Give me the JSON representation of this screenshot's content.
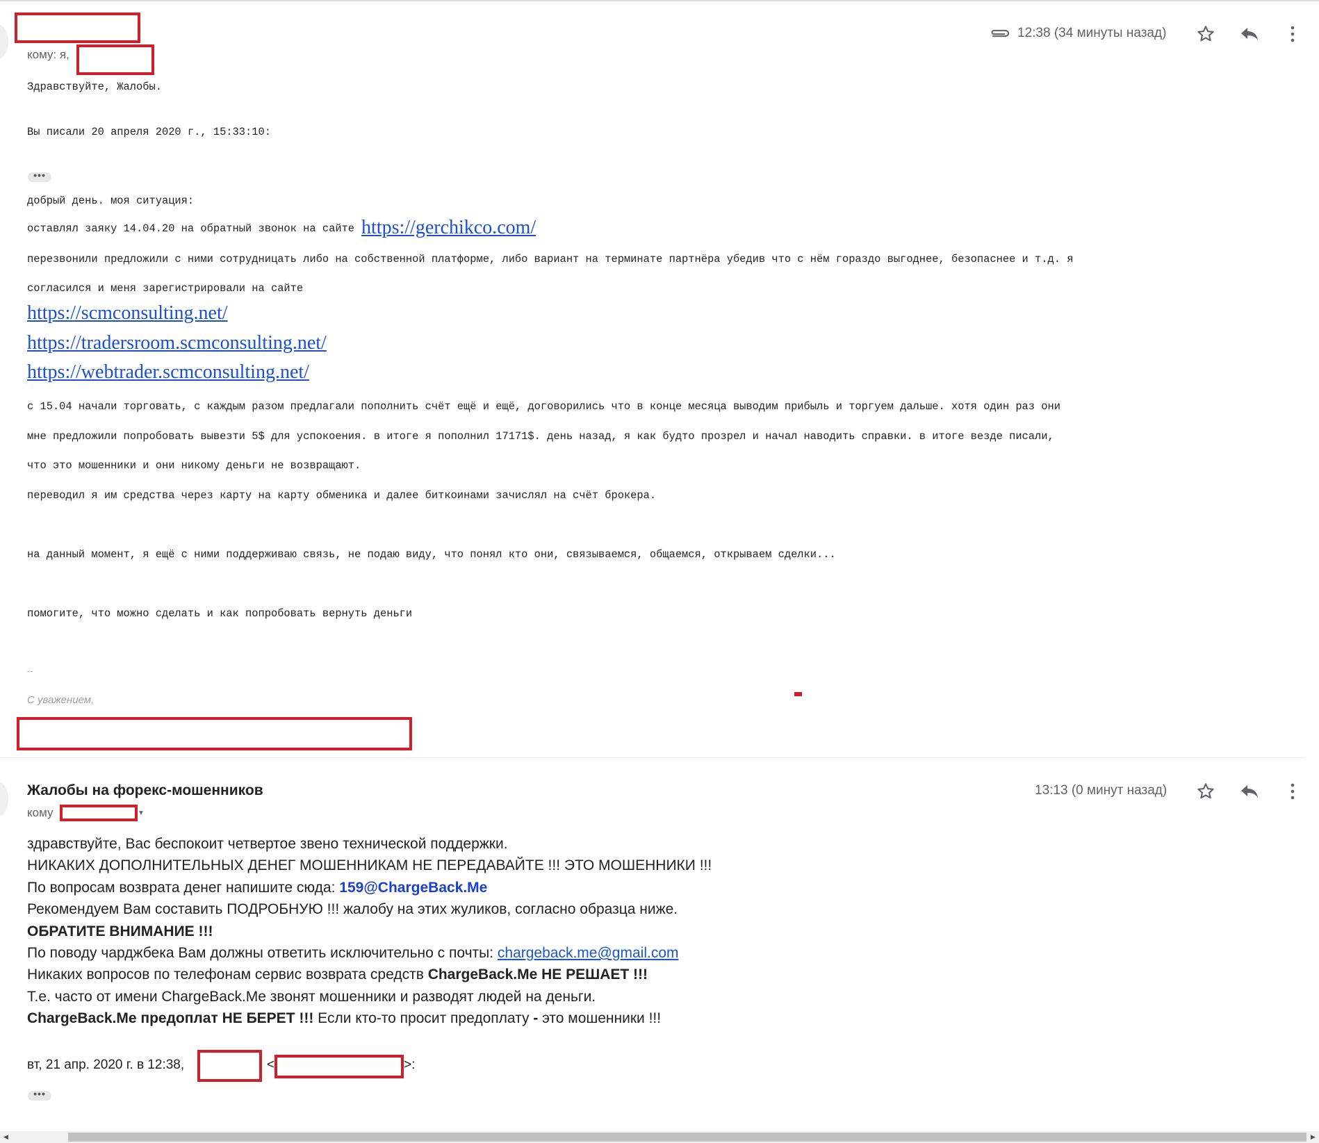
{
  "message1": {
    "to_label": "кому: я,",
    "time": "12:38 (34 минуты назад)",
    "icons": [
      "attachment-icon",
      "star-icon",
      "reply-icon",
      "more-vert-icon"
    ],
    "lines": {
      "greeting": "Здравствуйте, Жалобы.",
      "wrote": "Вы писали 20 апреля 2020 г., 15:33:10:",
      "ellipsis": "•••",
      "p1": "добрый день. моя ситуация:",
      "p2_text": "оставлял заяку 14.04.20 на обратный звонок на сайте",
      "p2_link": "https://gerchikco.com/",
      "p3": "перезвонили предложили с ними сотрудницать либо на собственной платформе, либо вариант на терминате партнёра убедив что с нём гораздо выгоднее, безопаснее и т.д. я",
      "p4": "согласился и меня зарегистрировали на сайте",
      "link1": "https://scmconsulting.net/",
      "link2": "https://tradersroom.scmconsulting.net/",
      "link3": "https://webtrader.scmconsulting.net/",
      "p5": "с 15.04 начали торговать, с каждым разом предлагали пополнить счёт ещё и ещё, договорились что в конце месяца выводим прибыль и торгуем дальше. хотя один раз они",
      "p6": "мне предложили попробовать вывезти 5$ для успокоения. в итоге я пополнил 17171$. день назад, я как будто прозрел и начал наводить справки. в итоге везде писали,",
      "p7": "что это мошенники и они никому деньги не возвращают.",
      "p8": "переводил я им средства через карту на карту обменика и далее биткоинами зачислял на счёт брокера.",
      "p9": "на данный момент, я ещё с ними поддерживаю связь, не подаю виду, что понял кто они, связываемся, общаемся, открываем сделки...",
      "p10": "помогите, что можно сделать и как попробовать вернуть деньги",
      "sig_dash": "--",
      "sig": "С уважением,"
    }
  },
  "message2": {
    "sender": "Жалобы на форекс-мошенников",
    "to_label": "кому",
    "time": "13:13 (0 минут назад)",
    "body": {
      "l1": "здравствуйте, Вас беспокоит четвертое звено технической поддержки.",
      "l2": "НИКАКИХ ДОПОЛНИТЕЛЬНЫХ ДЕНЕГ МОШЕННИКАМ НЕ ПЕРЕДАВАЙТЕ !!! ЭТО МОШЕННИКИ !!!",
      "l3_text": "По вопросам возврата денег напишите сюда: ",
      "l3_email": "159@ChargeBack.Me",
      "l4": "Рекомендуем Вам составить ПОДРОБНУЮ !!! жалобу на этих жуликов, согласно образца ниже.",
      "l5": "ОБРАТИТЕ ВНИМАНИЕ !!!",
      "l6_text": "По поводу чарджбека Вам должны ответить исключительно с почты: ",
      "l6_link": "chargeback.me@gmail.com",
      "l7_text": "Никаких вопросов по телефонам сервис возврата средств ",
      "l7_bold": "ChargeBack.Me НЕ РЕШАЕТ !!!",
      "l8": "Т.е. часто от имени ChargeBack.Me звонят мошенники и разводят людей на деньги.",
      "l9_bold": "ChargeBack.Me предоплат НЕ БЕРЕТ !!!",
      "l9_text": " Если кто-то просит предоплату ",
      "l9_dash": "-",
      "l9_end": " это мошенники !!!"
    },
    "quote_prefix": "вт, 21 апр. 2020 г. в 12:38,",
    "quote_lt": "<",
    "quote_gt": ">:",
    "ellipsis": "•••"
  },
  "colors": {
    "redaction": "#cf1f2a",
    "link": "#1a4fd6",
    "meta_text": "#5f6368"
  }
}
